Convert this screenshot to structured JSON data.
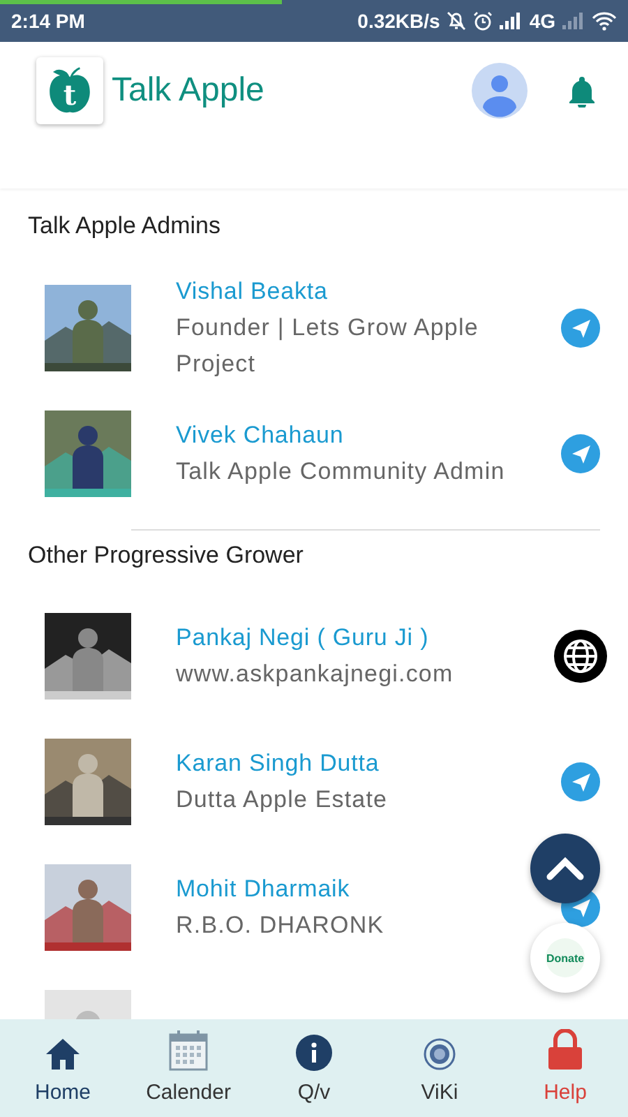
{
  "status_bar": {
    "time": "2:14 PM",
    "speed": "0.32KB/s",
    "network": "4G"
  },
  "header": {
    "logo_letter": "t",
    "title": "Talk Apple"
  },
  "sections": [
    {
      "title": "Talk Apple Admins",
      "people": [
        {
          "name": "Vishal Beakta",
          "subtitle": "Founder | Lets Grow Apple Project",
          "kind": "telegram"
        },
        {
          "name": "Vivek Chahaun",
          "subtitle": "Talk Apple Community Admin",
          "kind": "telegram"
        }
      ]
    },
    {
      "title": "Other Progressive Grower",
      "people": [
        {
          "name": "Pankaj Negi ( Guru Ji )",
          "subtitle": "www.askpankajnegi.com",
          "kind": "web"
        },
        {
          "name": "Karan Singh Dutta",
          "subtitle": "Dutta Apple Estate",
          "kind": "telegram"
        },
        {
          "name": "Mohit Dharmaik",
          "subtitle": "R.B.O. DHARONK",
          "kind": "telegram"
        }
      ]
    }
  ],
  "donate_label": "Donate",
  "nav": [
    {
      "kind": "home",
      "label": "Home",
      "color": "#1f3f66"
    },
    {
      "kind": "calendar",
      "label": "Calender",
      "color": "#333333"
    },
    {
      "kind": "info",
      "label": "Q/v",
      "color": "#333333"
    },
    {
      "kind": "viki",
      "label": "ViKi",
      "color": "#333333"
    },
    {
      "kind": "lock",
      "label": "Help",
      "color": "#d9413a"
    }
  ]
}
